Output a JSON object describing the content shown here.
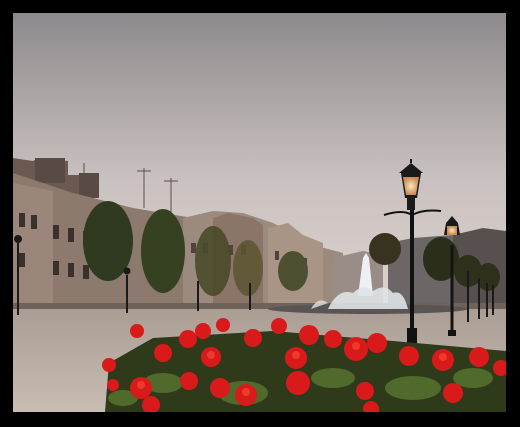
{
  "image": {
    "subject": "town-square-photo",
    "palette": {
      "sky_top": "#8f8a8c",
      "sky_bottom": "#d8d0cc",
      "building_dark": "#4a3f3c",
      "building_light": "#8a7a70",
      "pavement": "#bfb2a8",
      "flower_red": "#e01c1c",
      "foliage": "#3d4a22",
      "lamp_glow": "#f5c98a"
    }
  }
}
